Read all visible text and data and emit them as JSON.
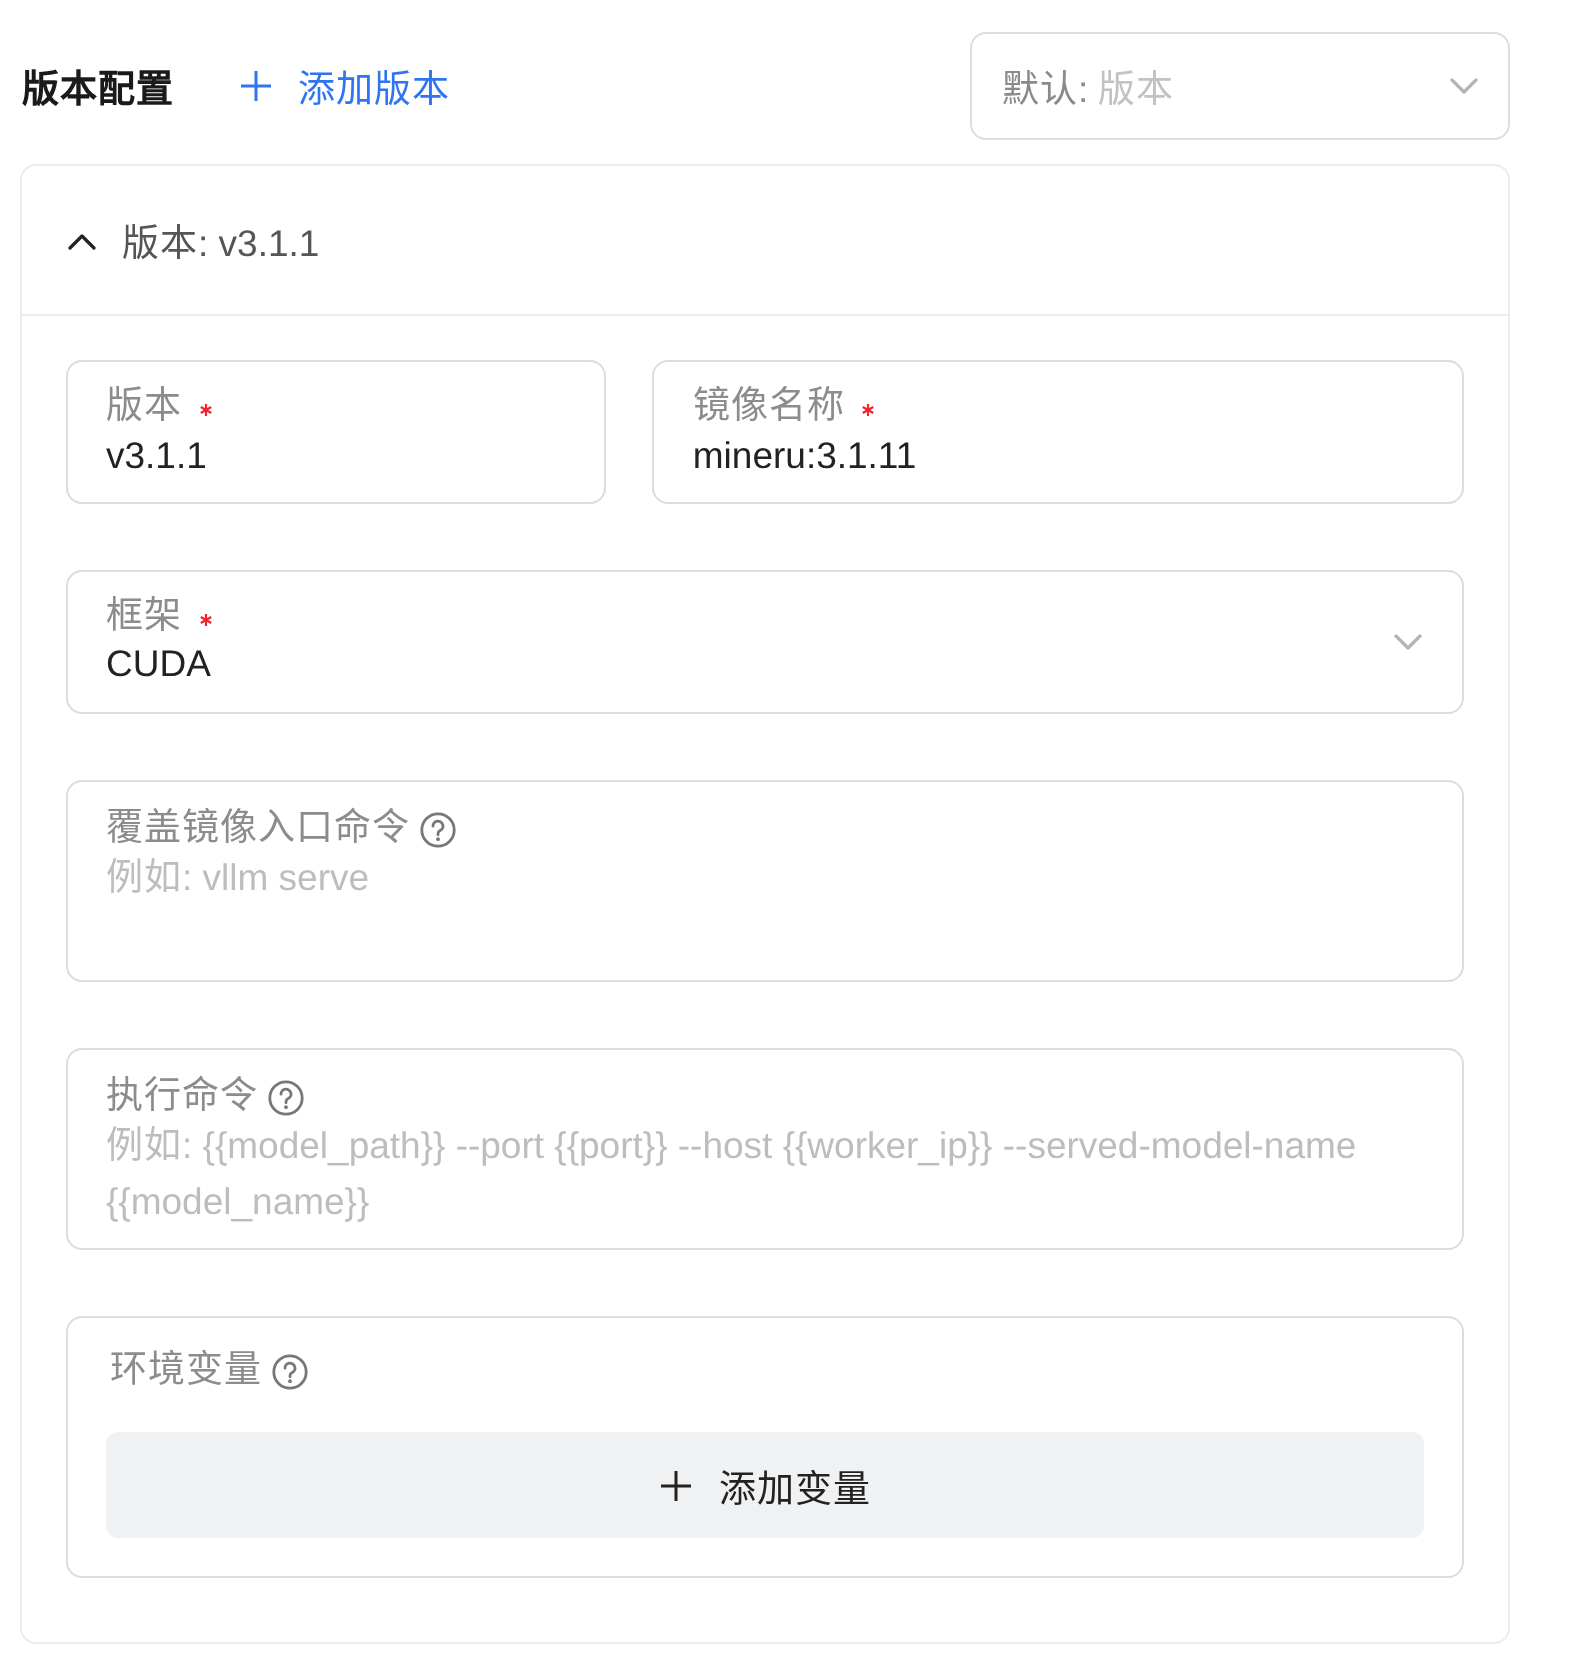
{
  "header": {
    "title": "版本配置",
    "add_button": {
      "label": "添加版本"
    },
    "default_select": {
      "label": "默认:",
      "placeholder": "版本"
    }
  },
  "versions": [
    {
      "title": "版本: v3.1.1",
      "expanded": true,
      "rows": [
        {
          "fields": [
            {
              "kind": "input",
              "label": "版本",
              "required": true,
              "value": "v3.1.1"
            },
            {
              "kind": "input",
              "label": "镜像名称",
              "required": true,
              "value": "mineru:3.1.11"
            }
          ]
        },
        {
          "fields": [
            {
              "kind": "select",
              "label": "框架",
              "required": true,
              "value": "CUDA"
            }
          ]
        },
        {
          "fields": [
            {
              "kind": "textarea",
              "label": "覆盖镜像入口命令",
              "help": true,
              "placeholder": "例如: vllm serve"
            }
          ]
        },
        {
          "fields": [
            {
              "kind": "textarea",
              "label": "执行命令",
              "help": true,
              "placeholder": "例如: {{model_path}} --port {{port}} --host {{worker_ip}} --served-model-name {{model_name}}"
            }
          ]
        }
      ],
      "env_vars": {
        "label": "环境变量",
        "help": true,
        "add_button": {
          "label": "添加变量"
        }
      }
    }
  ]
}
